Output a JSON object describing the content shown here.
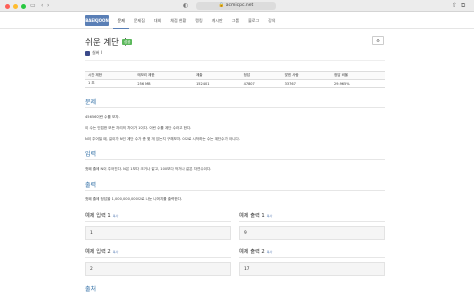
{
  "browser": {
    "url": "acmicpc.net",
    "colors": {
      "close": "#fe5f57",
      "minimize": "#febc2e",
      "maximize": "#28c840"
    }
  },
  "navbar": {
    "logo": "BAEKJOON",
    "items": [
      "문제",
      "문제집",
      "대회",
      "채점 현황",
      "랭킹",
      "게시판",
      "그룹",
      "블로그",
      "강의"
    ],
    "accent": "#5a7fb6"
  },
  "problem": {
    "title": "쉬운 계단 수",
    "status_badge": "성공",
    "option_icon": "gear-icon",
    "tier": "실버 I"
  },
  "info_table": {
    "headers": [
      "시간 제한",
      "메모리 제한",
      "제출",
      "정답",
      "맞힌 사람",
      "정답 비율"
    ],
    "row": [
      "1 초",
      "256 MB",
      "152401",
      "47807",
      "33767",
      "29.965%"
    ]
  },
  "sections": {
    "problem_heading": "문제",
    "problem_text_1": "45656이란 수를 보자.",
    "problem_text_2": "이 수는 인접한 모든 자리의 차이가 1이다. 이런 수를 계단 수라고 한다.",
    "problem_text_3": "N이 주어질 때, 길이가 N인 계단 수가 총 몇 개 있는지 구해보자. 0으로 시작하는 수는 계단수가 아니다.",
    "input_heading": "입력",
    "input_text": "첫째 줄에 N이 주어진다. N은 1보다 크거나 같고, 100보다 작거나 같은 자연수이다.",
    "output_heading": "출력",
    "output_text": "첫째 줄에 정답을 1,000,000,000으로 나눈 나머지를 출력한다.",
    "trailing_heading": "출처"
  },
  "examples": [
    {
      "input_label": "예제 입력 1",
      "input_value": "1",
      "output_label": "예제 출력 1",
      "output_value": "9"
    },
    {
      "input_label": "예제 입력 2",
      "input_value": "2",
      "output_label": "예제 출력 2",
      "output_value": "17"
    }
  ],
  "copy_label": "복사"
}
